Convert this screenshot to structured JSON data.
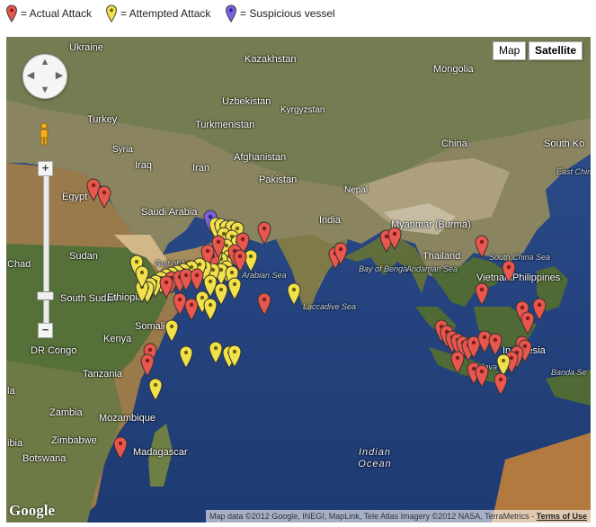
{
  "legend": {
    "actual_label": "= Actual Attack",
    "attempted_label": "= Attempted Attack",
    "suspicious_label": "= Suspicious vessel",
    "actual_color": "#e8564e",
    "attempted_color": "#f2e24a",
    "suspicious_color": "#7b62e0"
  },
  "map_type": {
    "map_label": "Map",
    "satellite_label": "Satellite",
    "selected": "Satellite"
  },
  "attribution": {
    "text": "Map data ©2012 Google, INEGI, MapLink, Tele Atlas Imagery ©2012 NASA, TerraMetrics - ",
    "terms": "Terms of Use"
  },
  "logo": "Google",
  "zoom": {
    "in_symbol": "+",
    "out_symbol": "−"
  },
  "pan": {
    "up": "▲",
    "down": "▼",
    "left": "◀",
    "right": "▶"
  },
  "labels": [
    {
      "id": "ukraine",
      "text": "Ukraine"
    },
    {
      "id": "kazakhstan",
      "text": "Kazakhstan"
    },
    {
      "id": "mongolia",
      "text": "Mongolia"
    },
    {
      "id": "uzbekistan",
      "text": "Uzbekistan"
    },
    {
      "id": "kyrgyzstan",
      "text": "Kyrgyzstan"
    },
    {
      "id": "turkey",
      "text": "Turkey"
    },
    {
      "id": "turkmenistan",
      "text": "Turkmenistan"
    },
    {
      "id": "syria",
      "text": "Syria"
    },
    {
      "id": "china",
      "text": "China"
    },
    {
      "id": "south-korea",
      "text": "South Ko"
    },
    {
      "id": "iraq",
      "text": "Iraq"
    },
    {
      "id": "iran",
      "text": "Iran"
    },
    {
      "id": "afghanistan",
      "text": "Afghanistan"
    },
    {
      "id": "east-china-sea",
      "text": "East China Sea"
    },
    {
      "id": "egypt",
      "text": "Egypt"
    },
    {
      "id": "pakistan",
      "text": "Pakistan"
    },
    {
      "id": "nepal",
      "text": "Nepal"
    },
    {
      "id": "saudi-arabia",
      "text": "Saudi Arabia"
    },
    {
      "id": "india",
      "text": "India"
    },
    {
      "id": "myanmar",
      "text": "Myanmar (Burma)"
    },
    {
      "id": "sudan",
      "text": "Sudan"
    },
    {
      "id": "thailand",
      "text": "Thailand"
    },
    {
      "id": "south-china-sea",
      "text": "South China Sea"
    },
    {
      "id": "chad",
      "text": "Chad"
    },
    {
      "id": "philippines",
      "text": "Philippines"
    },
    {
      "id": "gulf-of-aden",
      "text": "Gulf of Aden"
    },
    {
      "id": "arabian-sea",
      "text": "Arabian Sea"
    },
    {
      "id": "bay-of-bengal",
      "text": "Bay of Bengal"
    },
    {
      "id": "andaman-sea",
      "text": "Andaman Sea"
    },
    {
      "id": "vietnam",
      "text": "Vietnam"
    },
    {
      "id": "south-sudan",
      "text": "South Sudan"
    },
    {
      "id": "ethiopia",
      "text": "Ethiopia"
    },
    {
      "id": "somalia",
      "text": "Somalia"
    },
    {
      "id": "laccadive-sea",
      "text": "Laccadive Sea"
    },
    {
      "id": "dr-congo",
      "text": "DR Congo"
    },
    {
      "id": "kenya",
      "text": "Kenya"
    },
    {
      "id": "indonesia",
      "text": "Indonesia"
    },
    {
      "id": "tanzania",
      "text": "Tanzania"
    },
    {
      "id": "java-sea",
      "text": "Java Sea"
    },
    {
      "id": "banda-sea",
      "text": "Banda Se"
    },
    {
      "id": "angola",
      "text": "la"
    },
    {
      "id": "zambia",
      "text": "Zambia"
    },
    {
      "id": "mozambique",
      "text": "Mozambique"
    },
    {
      "id": "zimbabwe",
      "text": "Zimbabwe"
    },
    {
      "id": "madagascar",
      "text": "Madagascar"
    },
    {
      "id": "namibia",
      "text": "ibia"
    },
    {
      "id": "botswana",
      "text": "Botswana"
    },
    {
      "id": "indian-ocean",
      "text": "Indian Ocean"
    }
  ],
  "markers": [
    {
      "type": "actual",
      "lon": 34.5,
      "lat": 30.8
    },
    {
      "type": "actual",
      "lon": 36.5,
      "lat": 29.5
    },
    {
      "type": "suspicious",
      "lon": 56.0,
      "lat": 25.5
    },
    {
      "type": "attempted",
      "lon": 57.0,
      "lat": 24.2
    },
    {
      "type": "attempted",
      "lon": 58.0,
      "lat": 24.0
    },
    {
      "type": "attempted",
      "lon": 59.0,
      "lat": 23.8
    },
    {
      "type": "attempted",
      "lon": 60.0,
      "lat": 23.7
    },
    {
      "type": "attempted",
      "lon": 61.0,
      "lat": 23.4
    },
    {
      "type": "attempted",
      "lon": 58.5,
      "lat": 22.5
    },
    {
      "type": "attempted",
      "lon": 60.0,
      "lat": 22.0
    },
    {
      "type": "attempted",
      "lon": 61.0,
      "lat": 21.0
    },
    {
      "type": "attempted",
      "lon": 59.0,
      "lat": 20.5
    },
    {
      "type": "actual",
      "lon": 62.0,
      "lat": 21.5
    },
    {
      "type": "actual",
      "lon": 66.0,
      "lat": 23.5
    },
    {
      "type": "attempted",
      "lon": 63.5,
      "lat": 18.5
    },
    {
      "type": "attempted",
      "lon": 59.5,
      "lat": 18.5
    },
    {
      "type": "attempted",
      "lon": 58.0,
      "lat": 18.0
    },
    {
      "type": "attempted",
      "lon": 57.0,
      "lat": 19.0
    },
    {
      "type": "actual",
      "lon": 56.5,
      "lat": 18.5
    },
    {
      "type": "actual",
      "lon": 55.5,
      "lat": 19.5
    },
    {
      "type": "actual",
      "lon": 57.5,
      "lat": 21.0
    },
    {
      "type": "actual",
      "lon": 60.5,
      "lat": 19.5
    },
    {
      "type": "actual",
      "lon": 61.5,
      "lat": 18.5
    },
    {
      "type": "attempted",
      "lon": 59.0,
      "lat": 16.5
    },
    {
      "type": "attempted",
      "lon": 58.0,
      "lat": 16.0
    },
    {
      "type": "attempted",
      "lon": 60.0,
      "lat": 15.5
    },
    {
      "type": "attempted",
      "lon": 56.5,
      "lat": 16.0
    },
    {
      "type": "attempted",
      "lon": 55.0,
      "lat": 16.5
    },
    {
      "type": "attempted",
      "lon": 54.0,
      "lat": 17.0
    },
    {
      "type": "attempted",
      "lon": 52.5,
      "lat": 16.5
    },
    {
      "type": "attempted",
      "lon": 51.0,
      "lat": 16.0
    },
    {
      "type": "attempted",
      "lon": 50.0,
      "lat": 15.8
    },
    {
      "type": "attempted",
      "lon": 49.0,
      "lat": 15.4
    },
    {
      "type": "attempted",
      "lon": 48.0,
      "lat": 15.0
    },
    {
      "type": "attempted",
      "lon": 47.0,
      "lat": 14.5
    },
    {
      "type": "attempted",
      "lon": 46.0,
      "lat": 14.0
    },
    {
      "type": "attempted",
      "lon": 45.0,
      "lat": 13.5
    },
    {
      "type": "attempted",
      "lon": 44.5,
      "lat": 12.8
    },
    {
      "type": "attempted",
      "lon": 43.5,
      "lat": 13.0
    },
    {
      "type": "attempted",
      "lon": 42.5,
      "lat": 17.5
    },
    {
      "type": "attempted",
      "lon": 43.5,
      "lat": 15.5
    },
    {
      "type": "actual",
      "lon": 49.0,
      "lat": 14.5
    },
    {
      "type": "actual",
      "lon": 50.5,
      "lat": 14.8
    },
    {
      "type": "actual",
      "lon": 51.5,
      "lat": 15.0
    },
    {
      "type": "actual",
      "lon": 53.5,
      "lat": 15.0
    },
    {
      "type": "actual",
      "lon": 48.0,
      "lat": 13.8
    },
    {
      "type": "attempted",
      "lon": 56.0,
      "lat": 14.0
    },
    {
      "type": "attempted",
      "lon": 58.0,
      "lat": 12.5
    },
    {
      "type": "attempted",
      "lon": 60.5,
      "lat": 13.5
    },
    {
      "type": "attempted",
      "lon": 54.5,
      "lat": 11.0
    },
    {
      "type": "attempted",
      "lon": 56.0,
      "lat": 9.5
    },
    {
      "type": "actual",
      "lon": 50.5,
      "lat": 10.5
    },
    {
      "type": "actual",
      "lon": 52.5,
      "lat": 9.5
    },
    {
      "type": "attempted",
      "lon": 49.0,
      "lat": 5.5
    },
    {
      "type": "actual",
      "lon": 66.0,
      "lat": 10.5
    },
    {
      "type": "attempted",
      "lon": 71.5,
      "lat": 12.5
    },
    {
      "type": "attempted",
      "lon": 51.5,
      "lat": 0.5
    },
    {
      "type": "attempted",
      "lon": 57.0,
      "lat": 1.5
    },
    {
      "type": "attempted",
      "lon": 59.5,
      "lat": 0.5
    },
    {
      "type": "attempted",
      "lon": 60.5,
      "lat": 0.8
    },
    {
      "type": "actual",
      "lon": 45.0,
      "lat": 1.0
    },
    {
      "type": "actual",
      "lon": 44.5,
      "lat": -1.0
    },
    {
      "type": "attempted",
      "lon": 46.0,
      "lat": -5.5
    },
    {
      "type": "actual",
      "lon": 39.5,
      "lat": -16.5
    },
    {
      "type": "actual",
      "lon": 79.0,
      "lat": 19.0
    },
    {
      "type": "actual",
      "lon": 80.0,
      "lat": 19.8
    },
    {
      "type": "actual",
      "lon": 88.5,
      "lat": 22.0
    },
    {
      "type": "actual",
      "lon": 90.0,
      "lat": 22.5
    },
    {
      "type": "actual",
      "lon": 106.0,
      "lat": 21.0
    },
    {
      "type": "actual",
      "lon": 111.0,
      "lat": 16.5
    },
    {
      "type": "actual",
      "lon": 106.0,
      "lat": 12.5
    },
    {
      "type": "actual",
      "lon": 116.5,
      "lat": 9.5
    },
    {
      "type": "actual",
      "lon": 113.5,
      "lat": 9.0
    },
    {
      "type": "actual",
      "lon": 114.5,
      "lat": 7.0
    },
    {
      "type": "actual",
      "lon": 98.5,
      "lat": 5.5
    },
    {
      "type": "actual",
      "lon": 99.5,
      "lat": 4.5
    },
    {
      "type": "actual",
      "lon": 100.5,
      "lat": 3.5
    },
    {
      "type": "actual",
      "lon": 101.5,
      "lat": 3.0
    },
    {
      "type": "actual",
      "lon": 102.5,
      "lat": 2.5
    },
    {
      "type": "actual",
      "lon": 103.5,
      "lat": 2.0
    },
    {
      "type": "actual",
      "lon": 104.5,
      "lat": 2.5
    },
    {
      "type": "actual",
      "lon": 106.5,
      "lat": 3.5
    },
    {
      "type": "actual",
      "lon": 108.5,
      "lat": 3.0
    },
    {
      "type": "actual",
      "lon": 113.5,
      "lat": 2.5
    },
    {
      "type": "actual",
      "lon": 114.0,
      "lat": 1.8
    },
    {
      "type": "actual",
      "lon": 112.5,
      "lat": 0.5
    },
    {
      "type": "actual",
      "lon": 111.5,
      "lat": -0.5
    },
    {
      "type": "attempted",
      "lon": 110.0,
      "lat": -1.0
    },
    {
      "type": "actual",
      "lon": 104.5,
      "lat": -2.5
    },
    {
      "type": "actual",
      "lon": 106.0,
      "lat": -3.0
    },
    {
      "type": "actual",
      "lon": 109.5,
      "lat": -4.5
    },
    {
      "type": "actual",
      "lon": 101.5,
      "lat": -0.5
    }
  ]
}
